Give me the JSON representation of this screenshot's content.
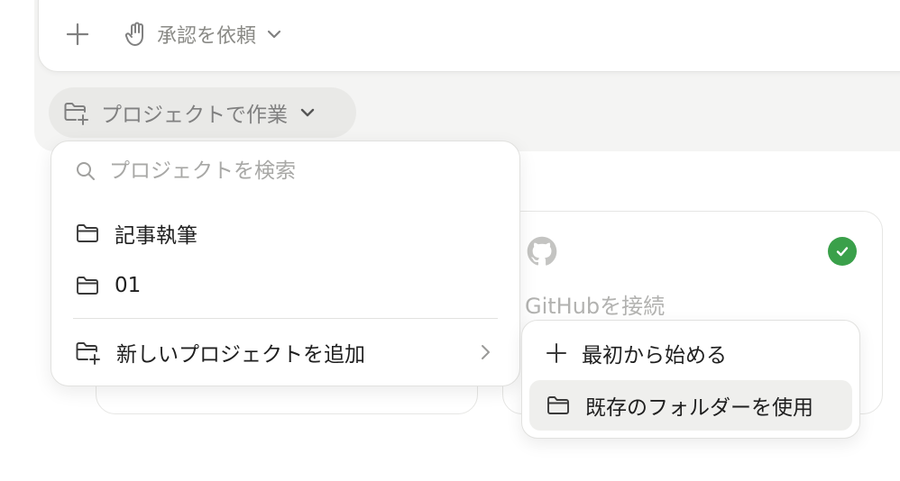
{
  "composer": {
    "approval_label": "承認を依頼"
  },
  "project_chip": {
    "label": "プロジェクトで作業"
  },
  "dropdown": {
    "search_placeholder": "プロジェクトを検索",
    "projects": [
      {
        "label": "記事執筆"
      },
      {
        "label": "01"
      }
    ],
    "add_project_label": "新しいプロジェクトを追加"
  },
  "github_card": {
    "label": "GitHubを接続",
    "connected_color": "#3aa04a"
  },
  "submenu": {
    "items": [
      {
        "label": "最初から始める",
        "icon": "plus-icon"
      },
      {
        "label": "既存のフォルダーを使用",
        "icon": "folder-icon"
      }
    ]
  }
}
